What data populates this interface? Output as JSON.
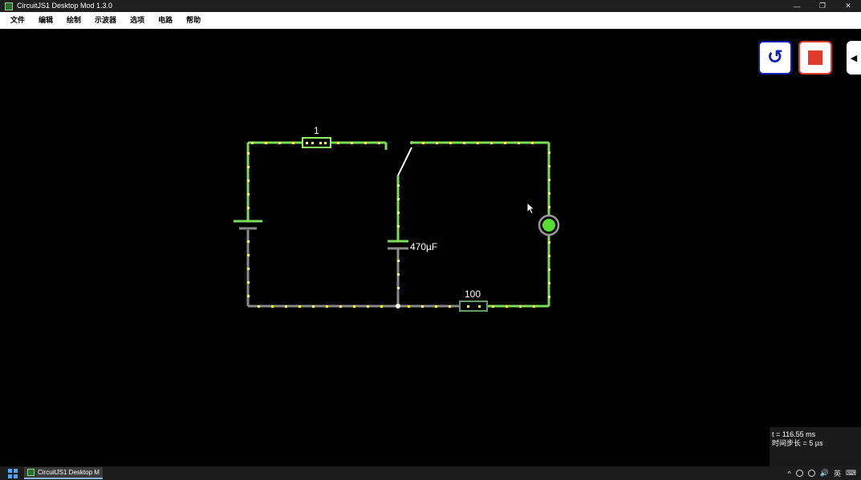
{
  "window": {
    "title": "CircuitJS1 Desktop Mod 1.3.0",
    "controls": {
      "minimize": "—",
      "restore": "❐",
      "close": "✕"
    }
  },
  "menu": [
    "文件",
    "编辑",
    "绘制",
    "示波器",
    "选项",
    "电路",
    "帮助"
  ],
  "toolbar": {
    "reset_icon": "↺",
    "side_toggle_icon": "◀"
  },
  "circuit": {
    "top_resistor_label": "1",
    "capacitor_label": "470µF",
    "bottom_resistor_label": "100",
    "colors": {
      "live_wire": "#7ddc5a",
      "ground_wire": "#8a8a8a",
      "current_dots": "#ffff44",
      "lamp_fill": "#55dd33",
      "resistor_top": "#8fef60",
      "resistor_bottom": "#6a9a6a"
    }
  },
  "status": {
    "time": "t = 116.55 ms",
    "timestep": "时间步长 = 5 µs"
  },
  "taskbar": {
    "app_label": "CircuitJS1 Desktop M...",
    "tray": {
      "chevron": "^",
      "ime": "英",
      "volume": "🔊",
      "network": "⌨"
    }
  }
}
